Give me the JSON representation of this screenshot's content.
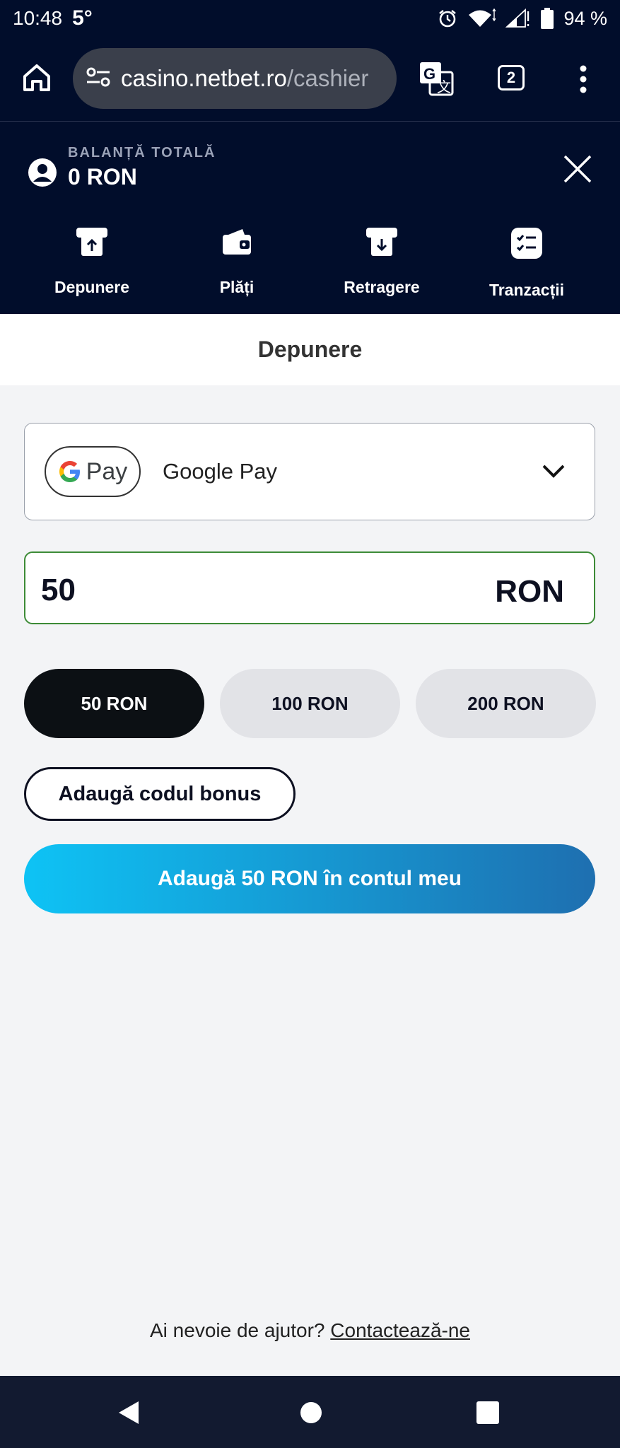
{
  "status_bar": {
    "time": "10:48",
    "temperature": "5°",
    "battery": "94 %"
  },
  "browser": {
    "url_host": "casino.netbet.ro",
    "url_path": "/cashier",
    "tab_count": "2"
  },
  "cashier": {
    "balance_label": "BALANȚĂ TOTALĂ",
    "balance_value": "0 RON",
    "nav": [
      {
        "label": "Depunere",
        "icon": "deposit-icon"
      },
      {
        "label": "Plăți",
        "icon": "wallet-icon"
      },
      {
        "label": "Retragere",
        "icon": "withdraw-icon"
      },
      {
        "label": "Tranzacții",
        "icon": "transactions-icon"
      }
    ]
  },
  "main": {
    "title": "Depunere",
    "method": {
      "badge_text": "Pay",
      "name": "Google Pay"
    },
    "amount": {
      "value": "50",
      "currency": "RON"
    },
    "quick_amounts": [
      "50 RON",
      "100 RON",
      "200 RON"
    ],
    "selected_quick_amount": "50 RON",
    "bonus_label": "Adaugă codul bonus",
    "submit_label": "Adaugă 50 RON în contul meu",
    "help_text": "Ai nevoie de ajutor?",
    "help_link": "Contactează-ne"
  },
  "colors": {
    "header_bg": "#010d2b",
    "accent_start": "#0ec3f5",
    "accent_end": "#1e6fb0",
    "input_border": "#3d8b37"
  }
}
